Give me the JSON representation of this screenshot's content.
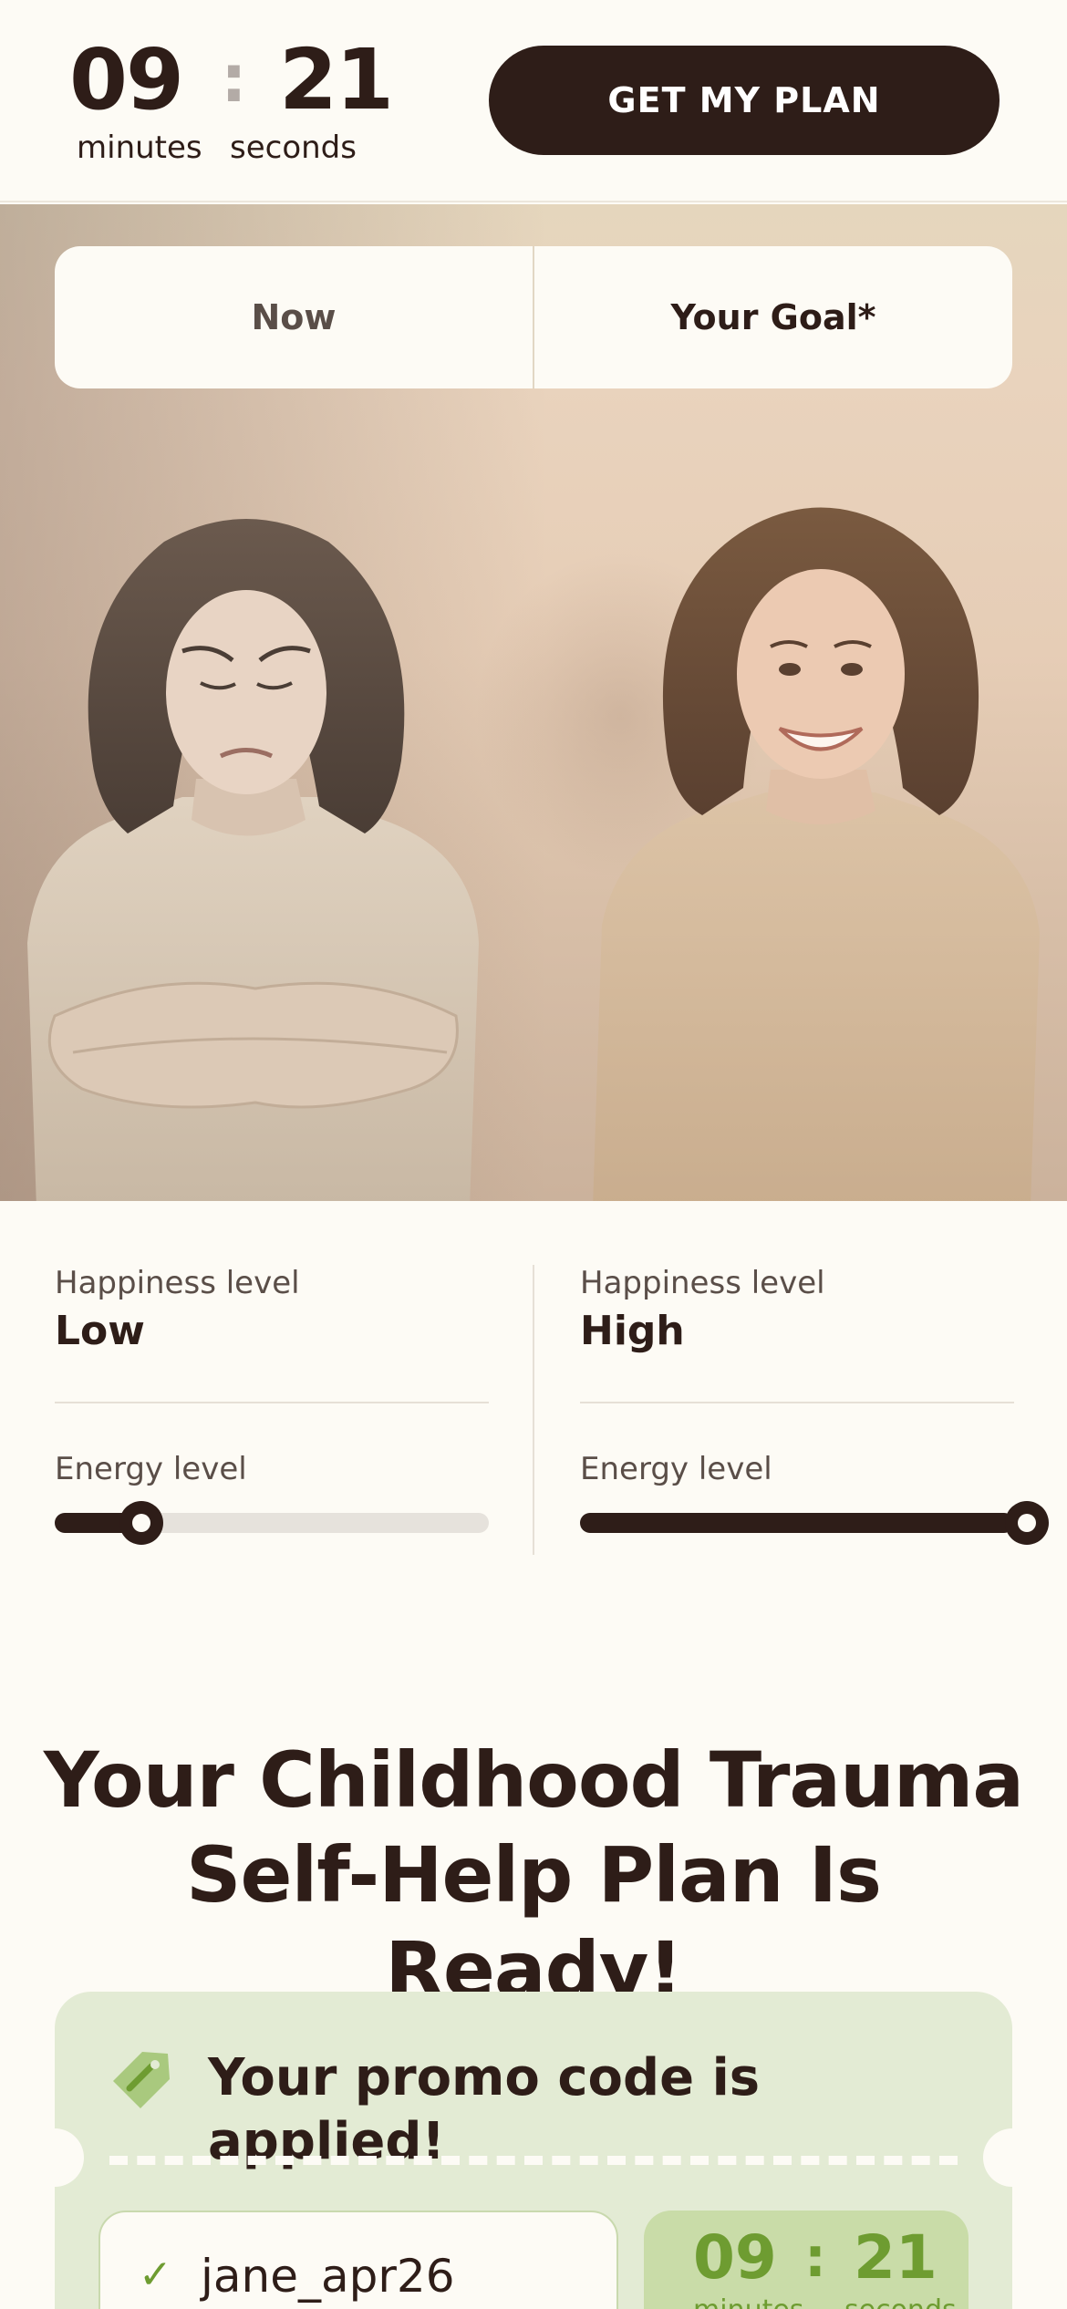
{
  "header": {
    "timer": {
      "minutes": "09",
      "seconds": "21",
      "minutes_label": "minutes",
      "seconds_label": "seconds",
      "separator": ":"
    },
    "cta_label": "GET MY PLAN"
  },
  "comparison": {
    "tabs": [
      {
        "label": "Now"
      },
      {
        "label": "Your Goal*"
      }
    ],
    "now": {
      "happiness_label": "Happiness level",
      "happiness_value": "Low",
      "energy_label": "Energy level",
      "energy_level": 0.2
    },
    "goal": {
      "happiness_label": "Happiness level",
      "happiness_value": "High",
      "energy_label": "Energy level",
      "energy_level": 1.0
    }
  },
  "headline": "Your Childhood Trauma Self-Help Plan Is Ready!",
  "promo": {
    "title": "Your promo code is applied!",
    "code": "jane_apr26",
    "timer": {
      "minutes": "09",
      "seconds": "21",
      "separator": ":",
      "minutes_label": "minutes",
      "seconds_label": "seconds"
    }
  },
  "colors": {
    "brand_dark": "#2e1d18",
    "promo_bg": "#e3ebd4",
    "promo_accent": "#6e9c31",
    "page_bg": "#fdfbf5"
  }
}
